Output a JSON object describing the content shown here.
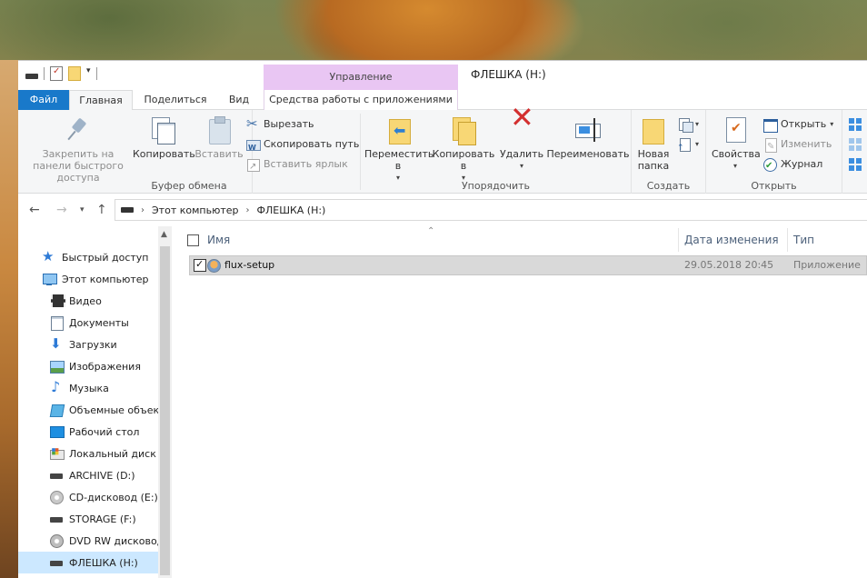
{
  "window": {
    "title": "ФЛЕШКА (H:)",
    "context_tab_header": "Управление"
  },
  "tabs": {
    "file": "Файл",
    "home": "Главная",
    "share": "Поделиться",
    "view": "Вид",
    "app_tools": "Средства работы с приложениями"
  },
  "ribbon": {
    "clipboard": {
      "label": "Буфер обмена",
      "pin": "Закрепить на панели быстрого доступа",
      "copy": "Копировать",
      "paste": "Вставить",
      "cut": "Вырезать",
      "copy_path": "Скопировать путь",
      "paste_shortcut": "Вставить ярлык"
    },
    "organize": {
      "label": "Упорядочить",
      "move_to": "Переместить в",
      "copy_to": "Копировать в",
      "delete": "Удалить",
      "rename": "Переименовать"
    },
    "new": {
      "label": "Создать",
      "new_folder": "Новая папка"
    },
    "open": {
      "label": "Открыть",
      "properties": "Свойства",
      "open": "Открыть",
      "edit": "Изменить",
      "history": "Журнал"
    }
  },
  "address": {
    "crumbs": [
      "Этот компьютер",
      "ФЛЕШКА (H:)"
    ]
  },
  "navpane": {
    "items": [
      {
        "label": "Быстрый доступ",
        "icon": "star-icon"
      },
      {
        "label": "Этот компьютер",
        "icon": "computer-icon"
      },
      {
        "label": "Видео",
        "icon": "video-icon"
      },
      {
        "label": "Документы",
        "icon": "documents-icon"
      },
      {
        "label": "Загрузки",
        "icon": "downloads-icon"
      },
      {
        "label": "Изображения",
        "icon": "pictures-icon"
      },
      {
        "label": "Музыка",
        "icon": "music-icon"
      },
      {
        "label": "Объемные объекты",
        "icon": "3d-objects-icon"
      },
      {
        "label": "Рабочий стол",
        "icon": "desktop-icon"
      },
      {
        "label": "Локальный диск (C:)",
        "icon": "hard-disk-icon"
      },
      {
        "label": "ARCHIVE (D:)",
        "icon": "drive-icon"
      },
      {
        "label": "CD-дисковод (E:)",
        "icon": "cd-drive-icon"
      },
      {
        "label": "STORAGE (F:)",
        "icon": "drive-icon"
      },
      {
        "label": "DVD RW дисковод",
        "icon": "dvd-drive-icon"
      },
      {
        "label": "ФЛЕШКА (H:)",
        "icon": "usb-drive-icon"
      }
    ]
  },
  "filelist": {
    "columns": {
      "name": "Имя",
      "date": "Дата изменения",
      "type": "Тип"
    },
    "rows": [
      {
        "name": "flux-setup",
        "date": "29.05.2018 20:45",
        "type": "Приложение"
      }
    ]
  }
}
